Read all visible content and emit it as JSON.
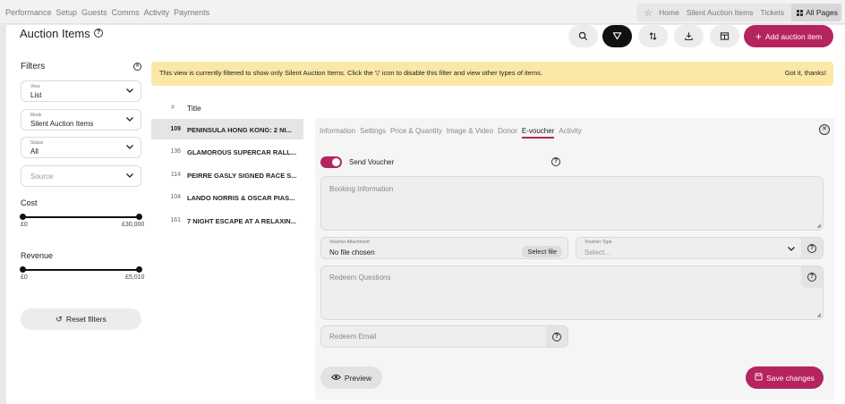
{
  "topnav": [
    "Performance",
    "Setup",
    "Guests",
    "Comms",
    "Activity",
    "Payments"
  ],
  "rightnav": {
    "items": [
      "Home",
      "Silent Auction Items",
      "Tickets"
    ],
    "all_pages": "All Pages",
    "star_icon": "star-icon"
  },
  "page": {
    "title": "Auction Items"
  },
  "toolbar": {
    "icons": [
      "search-icon",
      "filter-icon",
      "sort-icon",
      "download-icon",
      "columns-icon"
    ],
    "add_label": "Add auction item"
  },
  "filters": {
    "title": "Filters",
    "view": {
      "label": "View",
      "value": "List"
    },
    "mode": {
      "label": "Mode",
      "value": "Silent Auction Items"
    },
    "status": {
      "label": "Status",
      "value": "All"
    },
    "source": {
      "placeholder": "Source"
    },
    "cost": {
      "label": "Cost",
      "min": "£0",
      "max": "£30,000"
    },
    "revenue": {
      "label": "Revenue",
      "min": "£0",
      "max": "£5,010"
    },
    "reset_label": "Reset filters"
  },
  "banner": {
    "message": "This view is currently filtered to show only Silent Auction Items. Click the ▽ icon to disable this filter and view other types of items.",
    "dismiss": "Got it, thanks!"
  },
  "list": {
    "hash_header": "#",
    "title_header": "Title",
    "rows": [
      {
        "id": "109",
        "title": "PENINSULA HONG KONG: 2 NI..."
      },
      {
        "id": "136",
        "title": "GLAMOROUS SUPERCAR RALL..."
      },
      {
        "id": "114",
        "title": "PEIRRE GASLY SIGNED RACE S..."
      },
      {
        "id": "104",
        "title": "LANDO NORRIS & OSCAR PIAS..."
      },
      {
        "id": "161",
        "title": "7 NIGHT ESCAPE AT A RELAXIN..."
      }
    ]
  },
  "panel": {
    "tabs": [
      "Information",
      "Settings",
      "Price & Quantity",
      "Image & Video",
      "Donor",
      "E-voucher",
      "Activity"
    ],
    "active_tab": "E-voucher",
    "send_voucher_label": "Send Voucher",
    "send_voucher_on": true,
    "booking_placeholder": "Booking Information",
    "attachment": {
      "label": "Voucher Attachment",
      "value": "No file chosen",
      "button": "Select file"
    },
    "voucher_type": {
      "label": "Voucher Type",
      "placeholder": "Select..."
    },
    "redeem_questions_placeholder": "Redeem Questions",
    "redeem_email_placeholder": "Redeem Email",
    "preview_label": "Preview",
    "save_label": "Save changes"
  },
  "colors": {
    "accent": "#b5245f",
    "banner": "#fbe8a6"
  }
}
